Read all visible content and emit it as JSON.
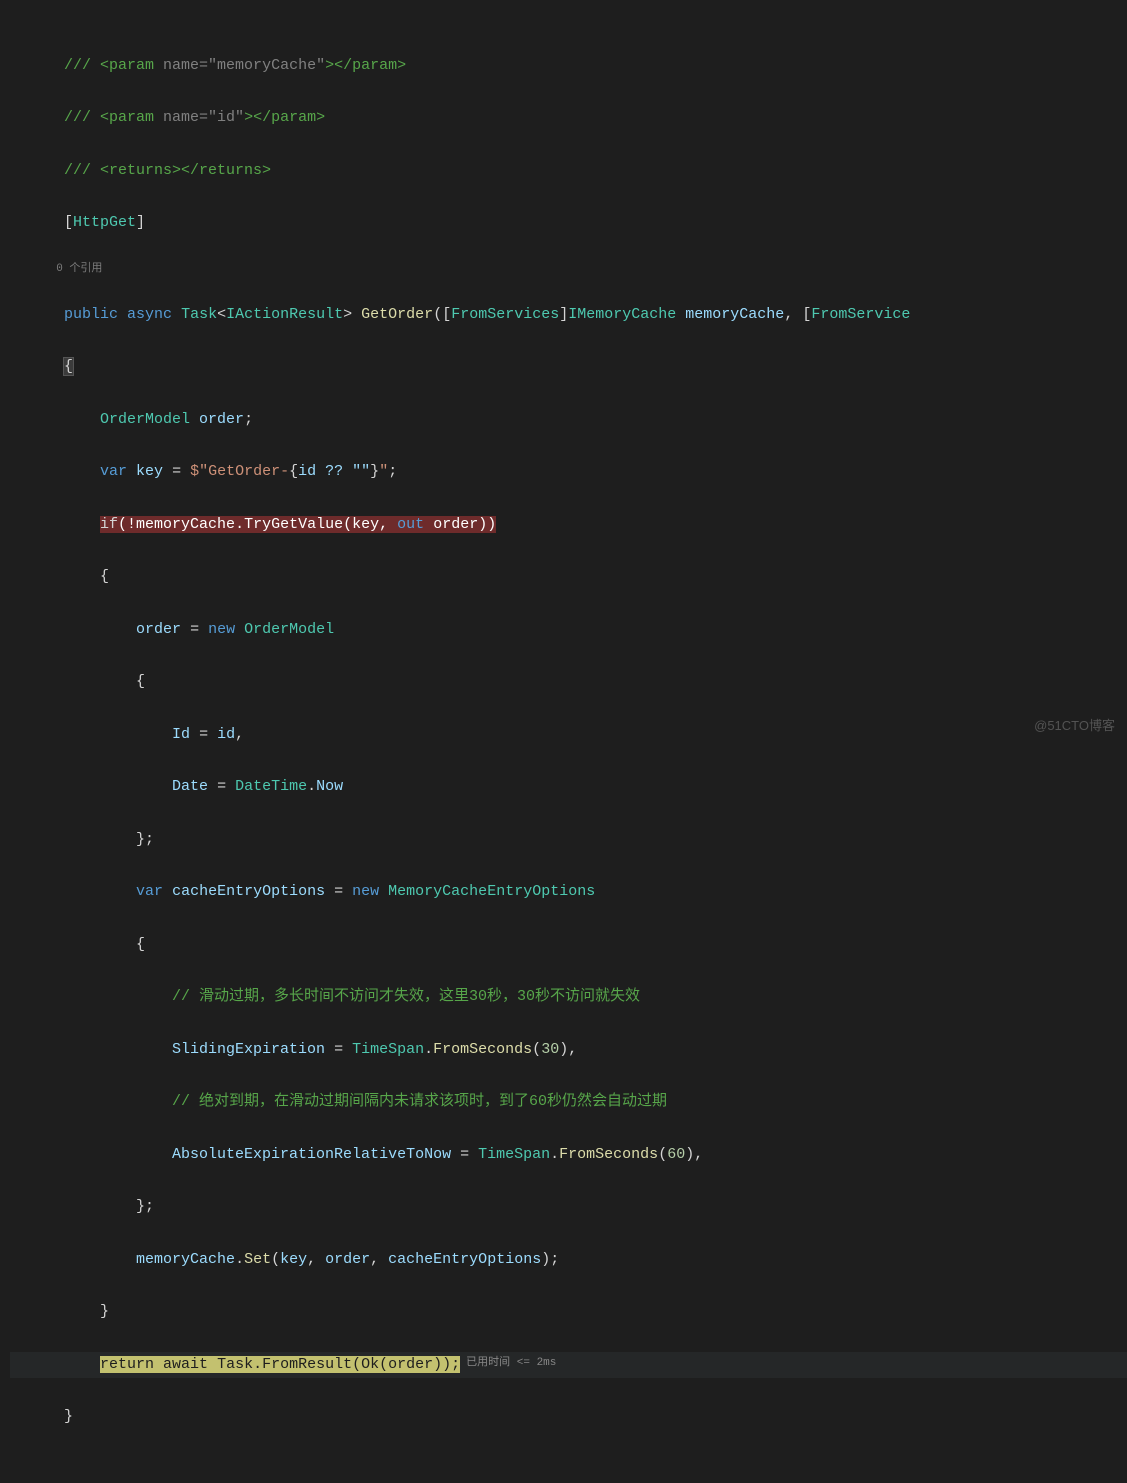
{
  "codelens": {
    "references": "0 个引用"
  },
  "xml": {
    "l1_open": "/// <param ",
    "l1_attr": "name=\"memoryCache\"",
    "l1_close": "></param>",
    "l2_open": "/// <param ",
    "l2_attr": "name=\"id\"",
    "l2_close": "></param>",
    "l3": "/// <returns></returns>"
  },
  "attr": {
    "httpget": "HttpGet",
    "fromservices": "FromServices"
  },
  "kw": {
    "public": "public",
    "async": "async",
    "var": "var",
    "if": "if",
    "out": "out",
    "new": "new",
    "return": "return",
    "await": "await"
  },
  "types": {
    "Task": "Task",
    "IActionResult": "IActionResult",
    "IMemoryCache": "IMemoryCache",
    "OrderModel": "OrderModel",
    "DateTime": "DateTime",
    "MemoryCacheEntryOptions": "MemoryCacheEntryOptions",
    "TimeSpan": "TimeSpan"
  },
  "ids": {
    "GetOrder": "GetOrder",
    "memoryCache": "memoryCache",
    "order": "order",
    "key": "key",
    "id": "id",
    "Id": "Id",
    "Date": "Date",
    "Now": "Now",
    "cacheEntryOptions": "cacheEntryOptions",
    "SlidingExpiration": "SlidingExpiration",
    "AbsoluteExpirationRelativeToNow": "AbsoluteExpirationRelativeToNow",
    "TryGetValue": "TryGetValue",
    "Set": "Set",
    "FromSeconds": "FromSeconds",
    "FromResult": "FromResult",
    "Ok": "Ok",
    "FromService_partial": "FromService"
  },
  "strings": {
    "interp_open": "$\"",
    "interp_text": "GetOrder-",
    "interp_hole_open": "{",
    "interp_hole_body": "id ?? \"\"",
    "interp_hole_close": "}",
    "interp_close": "\""
  },
  "numbers": {
    "n30": "30",
    "n60": "60"
  },
  "comments": {
    "sliding": "// 滑动过期，多长时间不访问才失效，这里30秒，30秒不访问就失效",
    "absolute": "// 绝对到期，在滑动过期间隔内未请求该项时，到了60秒仍然会自动过期"
  },
  "perf": {
    "elapsed": "已用时间 <= 2ms"
  },
  "watermark": "@51CTO博客"
}
